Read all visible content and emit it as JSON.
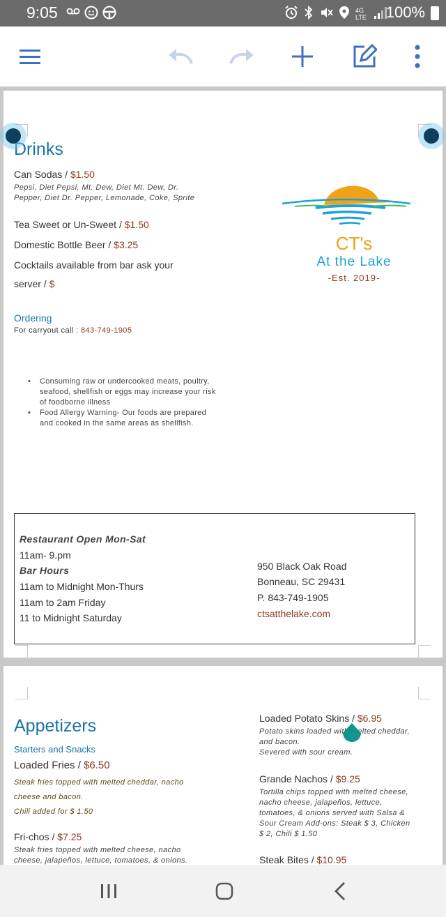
{
  "status": {
    "time": "9:05",
    "network": "4G LTE",
    "battery": "100%"
  },
  "toolbar": {
    "icons": [
      "menu-icon",
      "undo-icon",
      "redo-icon",
      "add-icon",
      "edit-icon",
      "more-icon"
    ]
  },
  "drinks": {
    "heading": "Drinks",
    "items": [
      {
        "name": "Can Sodas / ",
        "price": "$1.50"
      },
      {
        "name": "Tea Sweet or Un-Sweet / ",
        "price": "$1.50"
      },
      {
        "name": "Domestic Bottle Beer / ",
        "price": "$3.25"
      }
    ],
    "sodas_note_1": "Pepsi, Diet Pepsi, Mt. Dew, Diet Mt. Dew, Dr.",
    "sodas_note_2": "Pepper, Diet Dr. Pepper, Lemonade, Coke, Sprite",
    "cocktails_1": "Cocktails available from bar ask your",
    "cocktails_2": "server / ",
    "cocktails_price": "$"
  },
  "ordering": {
    "heading": "Ordering",
    "carryout_label": "For carryout call : ",
    "phone": "843-749-1905"
  },
  "warnings": [
    "Consuming raw or undercooked meats, poultry, seafood, shellfish or eggs may increase your risk of foodborne illness",
    "Food Allergy Warning- Our foods are prepared and cooked in the same areas as shellfish."
  ],
  "logo": {
    "title": "CT's",
    "subtitle": "At the Lake",
    "est": "-Est. 2019-"
  },
  "hours": {
    "restaurant_heading": "Restaurant Open Mon-Sat",
    "restaurant_hours": "11am- 9.pm",
    "bar_heading": "Bar Hours",
    "bar_1": "11am to Midnight Mon-Thurs",
    "bar_2": "11am to 2am Friday",
    "bar_3": "11 to Midnight Saturday",
    "address_1": "950 Black Oak Road",
    "address_2": "Bonneau, SC 29431",
    "phone": "P. 843-749-1905",
    "website": "ctsatthelake.com"
  },
  "appetizers": {
    "heading": "Appetizers",
    "subheading": "Starters and Snacks",
    "loaded_fries": {
      "name": "Loaded Fries / ",
      "price": "$6.50",
      "desc_1": "Steak fries topped with melted cheddar, nacho",
      "desc_2": "cheese and bacon.",
      "desc_3": "Chili added for $ 1.50"
    },
    "frichos": {
      "name": "Fri-chos / ",
      "price": "$7.25",
      "desc_1": "Steak fries topped with melted cheese, nacho",
      "desc_2": "cheese, jalapeños, lettuce, tomatoes, & onions."
    },
    "potato_skins": {
      "name": "Loaded Potato Skins / ",
      "price": "$6.95",
      "desc_1": "Potato skins loaded with melted cheddar,",
      "desc_2": "and bacon.",
      "desc_3": "Severed with sour cream."
    },
    "nachos": {
      "name": "Grande Nachos / ",
      "price": "$9.25",
      "desc_1": "Tortilla chips topped with melted cheese,",
      "desc_2": "nacho cheese, jalapeños, lettuce,",
      "desc_3": "tomatoes, & onions served with Salsa &",
      "desc_4": "Sour Cream Add-ons: Steak $ 3, Chicken",
      "desc_5": "$ 2, Chili $ 1.50"
    },
    "steak_bites": {
      "name": "Steak Bites / ",
      "price": "$10.95"
    }
  },
  "colors": {
    "accent_blue": "#1a73a8",
    "price_brown": "#8a3b1f",
    "toolbar_blue": "#3f6fc0"
  }
}
